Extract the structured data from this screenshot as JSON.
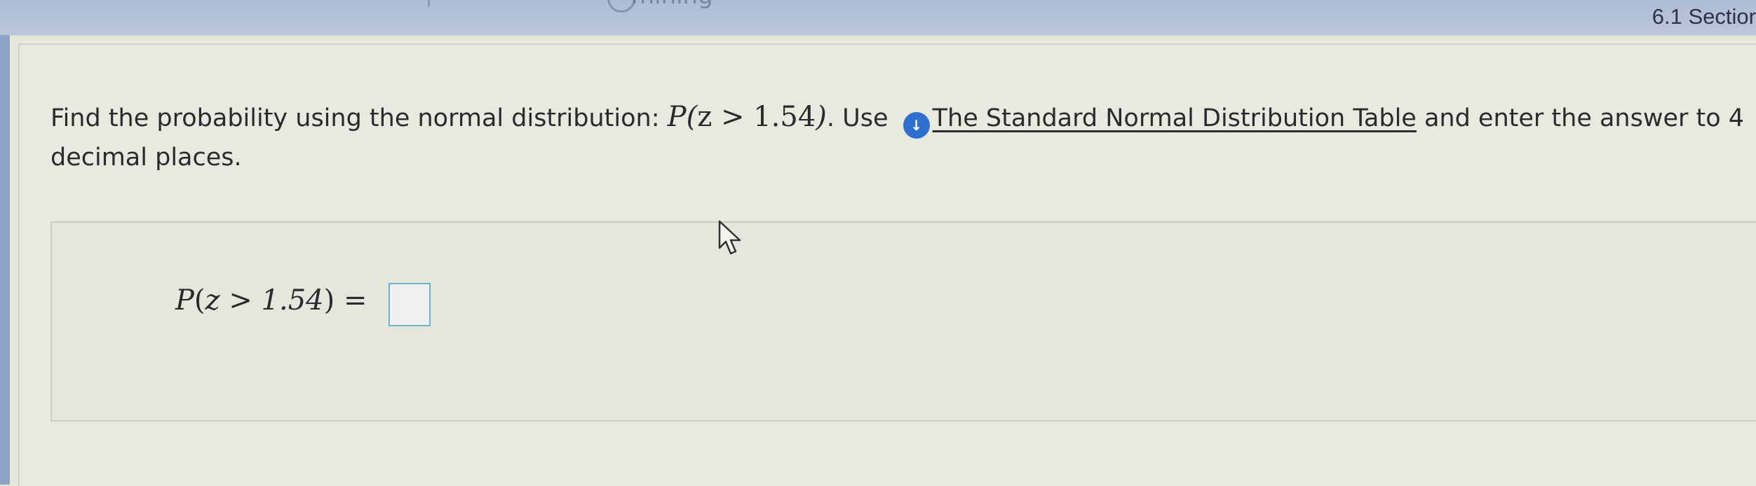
{
  "header": {
    "section": "6.1 Sectior",
    "cut_off_text": "mining"
  },
  "question": {
    "lead": "Find the probability using the normal distribution:",
    "math_var": "P",
    "math_inner": "z > 1.54",
    "after_math": ". Use",
    "link_text": "The Standard Normal Distribution Table",
    "trailing": " and enter the answer to 4 decimal places."
  },
  "answer": {
    "expr_var": "P",
    "expr_inner": "z > 1.54",
    "equals": "=",
    "input_value": ""
  },
  "icons": {
    "info": "info-download-icon",
    "cursor": "mouse-pointer-icon"
  },
  "colors": {
    "header_bg": "#b3c1d8",
    "info_icon": "#2f6fd0",
    "input_border": "#6fb2c9",
    "page_bg": "#e7e8dc"
  }
}
